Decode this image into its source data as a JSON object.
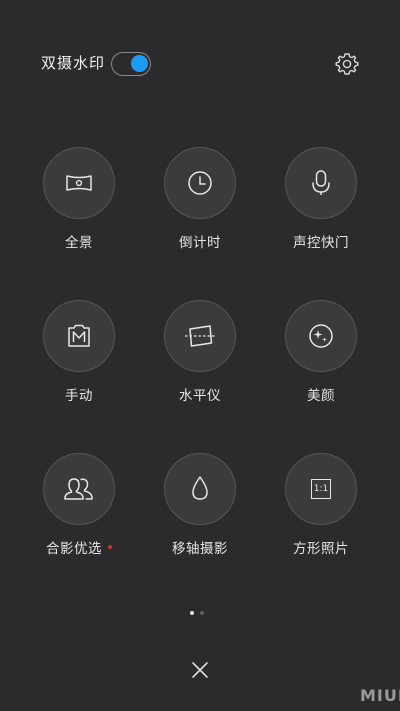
{
  "header": {
    "dual_watermark_label": "双摄水印",
    "dual_watermark_enabled": true,
    "settings_icon": "gear-icon"
  },
  "modes": [
    {
      "label": "全景",
      "icon": "panorama-icon"
    },
    {
      "label": "倒计时",
      "icon": "clock-icon"
    },
    {
      "label": "声控快门",
      "icon": "microphone-icon"
    },
    {
      "label": "手动",
      "icon": "manual-icon"
    },
    {
      "label": "水平仪",
      "icon": "level-icon"
    },
    {
      "label": "美颜",
      "icon": "beauty-icon"
    },
    {
      "label": "合影优选",
      "icon": "group-photo-icon",
      "new_badge": true
    },
    {
      "label": "移轴摄影",
      "icon": "tilt-shift-icon"
    },
    {
      "label": "方形照片",
      "icon": "square-icon",
      "icon_text": "1:1"
    }
  ],
  "pager": {
    "pages": 2,
    "current": 1
  },
  "footer": {
    "close_icon": "close-icon"
  },
  "watermark": {
    "logo": "MIUI"
  },
  "colors": {
    "accent": "#1a9df2",
    "background": "#2b2b2d",
    "badge": "#d8322d"
  }
}
